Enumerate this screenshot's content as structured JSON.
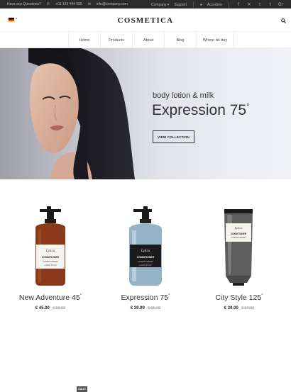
{
  "topbar": {
    "question": "Have any Questions?",
    "phone": "+01 123 444 555",
    "email": "info@company.com",
    "company": "Company",
    "support": "Support",
    "account": "Accedere",
    "social_icons": [
      "facebook-icon",
      "xing-icon",
      "twitter-icon",
      "tumblr-icon",
      "google-plus-icon"
    ],
    "social_glyphs": [
      "f",
      "✕",
      "t",
      "t",
      "G+"
    ]
  },
  "header": {
    "logo": "COSMETICA",
    "language_flag": "de",
    "flag_colors": [
      "#000000",
      "#dd0000",
      "#ffce00"
    ]
  },
  "nav": {
    "items": [
      "Home",
      "Products",
      "About",
      "Blog",
      "Where do buy"
    ]
  },
  "hero": {
    "subtitle": "body lotion & milk",
    "title": "Expression 75",
    "title_sup": "°",
    "cta": "VIEW COLLECTION"
  },
  "products": [
    {
      "name": "New Adventure 45",
      "sup": "°",
      "price": "€ 45.00",
      "old_price": "€ 50.00",
      "badge": "SALE!"
    },
    {
      "name": "Expression 75",
      "sup": "°",
      "price": "€ 39.99",
      "old_price": "€ 55.00"
    },
    {
      "name": "City Style 125",
      "sup": "°",
      "price": "€ 29.00",
      "old_price": "€ 34.00"
    }
  ],
  "label_text": {
    "brand": "Lytica",
    "line1": "CONDITIONER",
    "line2": "CONDITIONER",
    "tagline": "LOREM IPSUM"
  }
}
